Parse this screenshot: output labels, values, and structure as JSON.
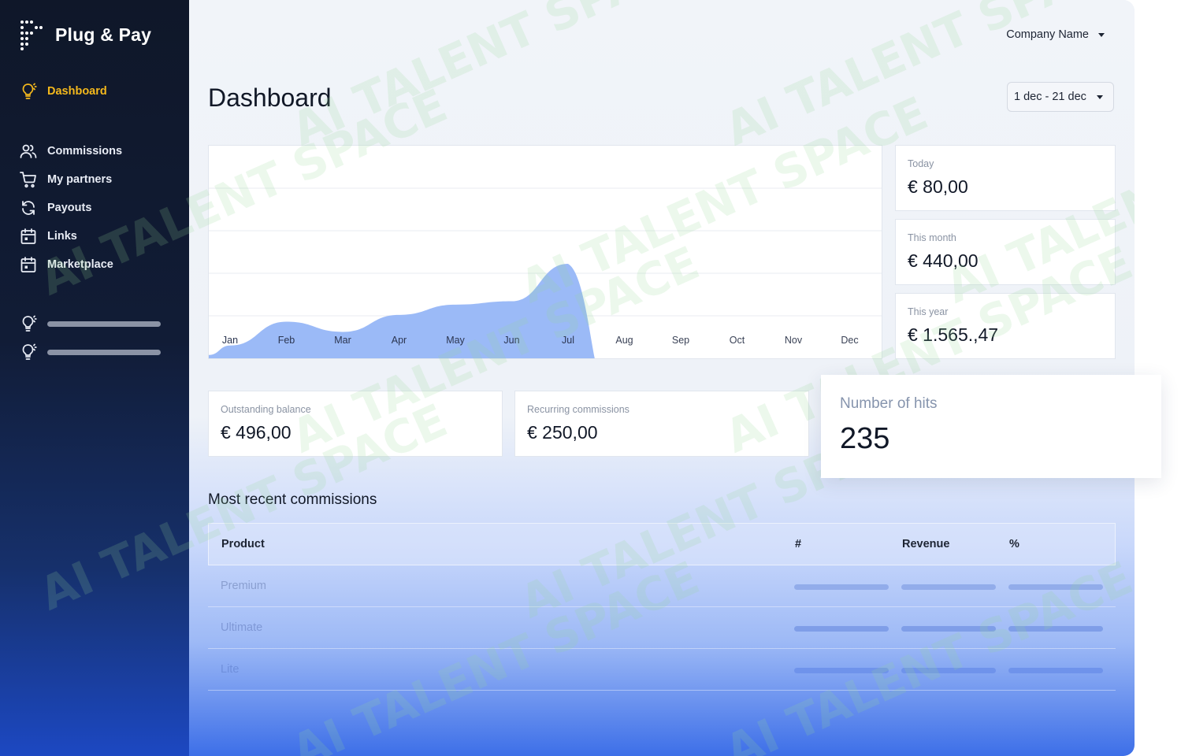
{
  "brand": {
    "name": "Plug & Pay"
  },
  "sidebar": {
    "items": [
      {
        "label": "Dashboard",
        "icon": "lightbulb-icon",
        "active": true
      },
      {
        "label": "Commissions",
        "icon": "users-icon"
      },
      {
        "label": "My partners",
        "icon": "cart-icon"
      },
      {
        "label": "Payouts",
        "icon": "refresh-icon"
      },
      {
        "label": "Links",
        "icon": "calendar-icon"
      },
      {
        "label": "Marketplace",
        "icon": "calendar-icon"
      }
    ],
    "placeholders": [
      {
        "icon": "lightbulb-icon"
      },
      {
        "icon": "lightbulb-icon"
      }
    ]
  },
  "header": {
    "company": "Company Name",
    "title": "Dashboard",
    "date_range": "1 dec - 21 dec"
  },
  "chart_data": {
    "type": "area",
    "categories": [
      "Jan",
      "Feb",
      "Mar",
      "Apr",
      "May",
      "Jun",
      "Jul",
      "Aug",
      "Sep",
      "Oct",
      "Nov",
      "Dec"
    ],
    "values": [
      0.4,
      1.1,
      0.8,
      1.3,
      1.6,
      1.7,
      2.8,
      null,
      null,
      null,
      null,
      null
    ],
    "ylim": [
      0,
      5
    ],
    "grid": true,
    "color": "#9bbaf7"
  },
  "stats": {
    "today": {
      "label": "Today",
      "value": "€ 80,00"
    },
    "month": {
      "label": "This month",
      "value": "€ 440,00"
    },
    "year": {
      "label": "This year",
      "value": "€ 1.565.,47"
    },
    "outstanding": {
      "label": "Outstanding balance",
      "value": "€ 496,00"
    },
    "recurring": {
      "label": "Recurring commissions",
      "value": "€ 250,00"
    },
    "hits": {
      "label": "Number of hits",
      "value": "235"
    }
  },
  "commissions": {
    "title": "Most recent commissions",
    "columns": [
      "Product",
      "#",
      "Revenue",
      "%"
    ],
    "rows": [
      {
        "product": "Premium"
      },
      {
        "product": "Ultimate"
      },
      {
        "product": "Lite"
      }
    ]
  },
  "watermark": "AI TALENT SPACE",
  "colors": {
    "accent": "#f4b81c",
    "sidebar": "#0f1729",
    "chart": "#9bbaf7",
    "primary": "#3d6fe8"
  }
}
